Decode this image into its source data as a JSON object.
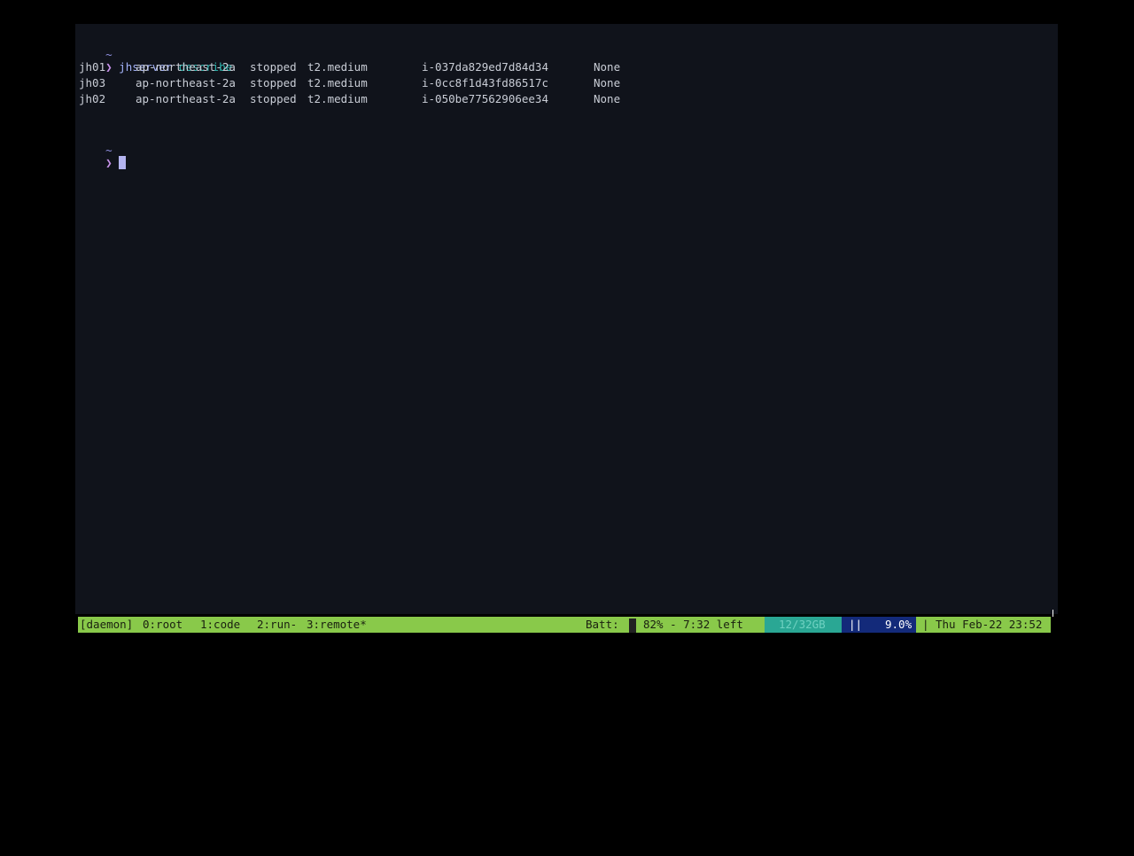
{
  "terminal": {
    "prompt_dir_1": "~",
    "prompt_symbol": "❯",
    "command": "jhserver",
    "command_arg": "describe",
    "rows": [
      {
        "name": "jh01",
        "region": "ap-northeast-2a",
        "state": "stopped",
        "type": "t2.medium",
        "id": "i-037da829ed7d84d34",
        "ip": "None"
      },
      {
        "name": "jh03",
        "region": "ap-northeast-2a",
        "state": "stopped",
        "type": "t2.medium",
        "id": "i-0cc8f1d43fd86517c",
        "ip": "None"
      },
      {
        "name": "jh02",
        "region": "ap-northeast-2a",
        "state": "stopped",
        "type": "t2.medium",
        "id": "i-050be77562906ee34",
        "ip": "None"
      }
    ],
    "prompt_dir_2": "~"
  },
  "statusbar": {
    "session": "[daemon]",
    "windows": [
      "0:root",
      "1:code",
      "2:run-",
      "3:remote*"
    ],
    "batt_label": "Batt:",
    "battery": "82% - 7:32 left",
    "load": "12/32GB",
    "cpu_bar": "||",
    "cpu": "9.0%",
    "separator": "|",
    "datetime": "Thu Feb-22 23:52"
  },
  "colors": {
    "terminal_bg": "#10131b",
    "statusbar_bg": "#89c94a",
    "accent_teal": "#2bb7b0",
    "accent_purple": "#a5b4fc"
  }
}
